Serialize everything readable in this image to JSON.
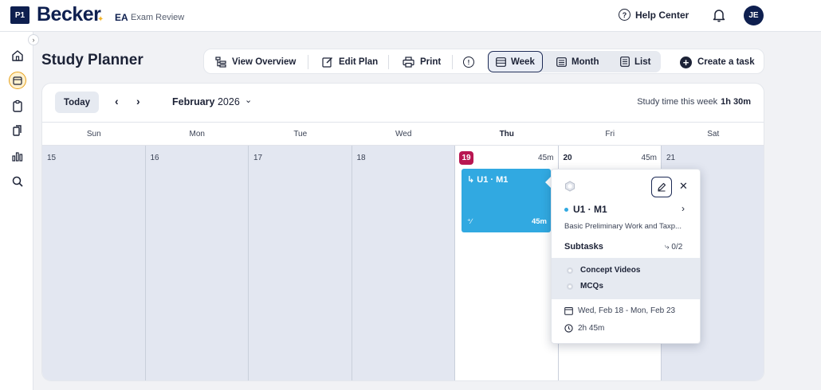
{
  "header": {
    "logo_badge": "P1",
    "brand": "Becker",
    "product_code": "EA",
    "product_name": "Exam Review",
    "help_label": "Help Center",
    "avatar_initials": "JE"
  },
  "sidebar": {
    "items": [
      {
        "icon": "home-icon"
      },
      {
        "icon": "calendar-icon",
        "active": true
      },
      {
        "icon": "clipboard-icon"
      },
      {
        "icon": "documents-icon"
      },
      {
        "icon": "chart-icon"
      },
      {
        "icon": "search-icon"
      }
    ]
  },
  "page": {
    "title": "Study Planner"
  },
  "toolbar": {
    "view_overview": "View Overview",
    "edit_plan": "Edit Plan",
    "print": "Print",
    "info_icon": "info-icon",
    "views": [
      "Week",
      "Month",
      "List"
    ],
    "active_view": "Week",
    "create_task": "Create a task"
  },
  "calendar": {
    "today_label": "Today",
    "month": "February",
    "year": "2026",
    "study_time_label": "Study time this week",
    "study_time_value": "1h 30m",
    "day_names": [
      "Sun",
      "Mon",
      "Tue",
      "Wed",
      "Thu",
      "Fri",
      "Sat"
    ],
    "days": [
      {
        "num": "15",
        "duration": ""
      },
      {
        "num": "16",
        "duration": ""
      },
      {
        "num": "17",
        "duration": ""
      },
      {
        "num": "18",
        "duration": ""
      },
      {
        "num": "19",
        "duration": "45m",
        "today": true
      },
      {
        "num": "20",
        "duration": "45m"
      },
      {
        "num": "21",
        "duration": ""
      }
    ],
    "event": {
      "title": "U1 · M1",
      "duration": "45m"
    }
  },
  "popover": {
    "title": "U1 · M1",
    "description": "Basic Preliminary Work and Taxp...",
    "subtasks_label": "Subtasks",
    "subtasks_count": "0/2",
    "subtasks": [
      "Concept Videos",
      "MCQs"
    ],
    "date_range": "Wed, Feb 18 - Mon, Feb 23",
    "total_time": "2h 45m"
  },
  "colors": {
    "brand_navy": "#0e1f4f",
    "accent_gold": "#f3b52a",
    "event_blue": "#31a9e1",
    "today_badge": "#b81651"
  }
}
